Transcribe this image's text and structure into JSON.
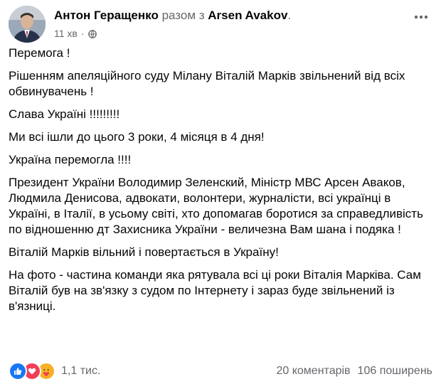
{
  "post": {
    "author": "Антон Геращенко",
    "with_text": "разом з",
    "coauthor": "Arsen Avakov",
    "coauthor_suffix": ".",
    "time": "11 хв",
    "separator": "·",
    "audience_icon": "globe-icon",
    "more_icon": "more-options-icon"
  },
  "body": {
    "paragraphs": [
      "Перемога !",
      "Рішенням апеляційного суду Мілану Віталій Марків звільнений від всіх обвинувачень !",
      "Слава Україні !!!!!!!!!",
      "Ми всі ішли до цього 3 роки, 4 місяця в 4 дня!",
      "Україна перемогла !!!!",
      "Президент України Володимир Зеленский, Міністр МВС Арсен Аваков, Людмила Денисова, адвокати, волонтери, журналісти, всі українці в Україні, в Італії, в усьому світі, хто допомагав боротися за справедливість по відношенню дт Захисника України - величезна Вам шана і подяка !",
      "Віталій Марків вільний і повертається в Україну!",
      "На фото - частина команди яка рятувала всі ці роки Віталія Марківа.  Сам Віталій був на зв'язку з судом по Інтернету і зараз буде звільнений із в'язниці."
    ]
  },
  "footer": {
    "reactions": [
      "like-icon",
      "love-icon",
      "care-icon"
    ],
    "reaction_count": "1,1 тис.",
    "comments": "20 коментарів",
    "shares": "106 поширень"
  },
  "colors": {
    "text": "#050505",
    "secondary": "#65676b",
    "like": "#1877f2",
    "love": "#f33e58",
    "care": "#f7b125"
  }
}
